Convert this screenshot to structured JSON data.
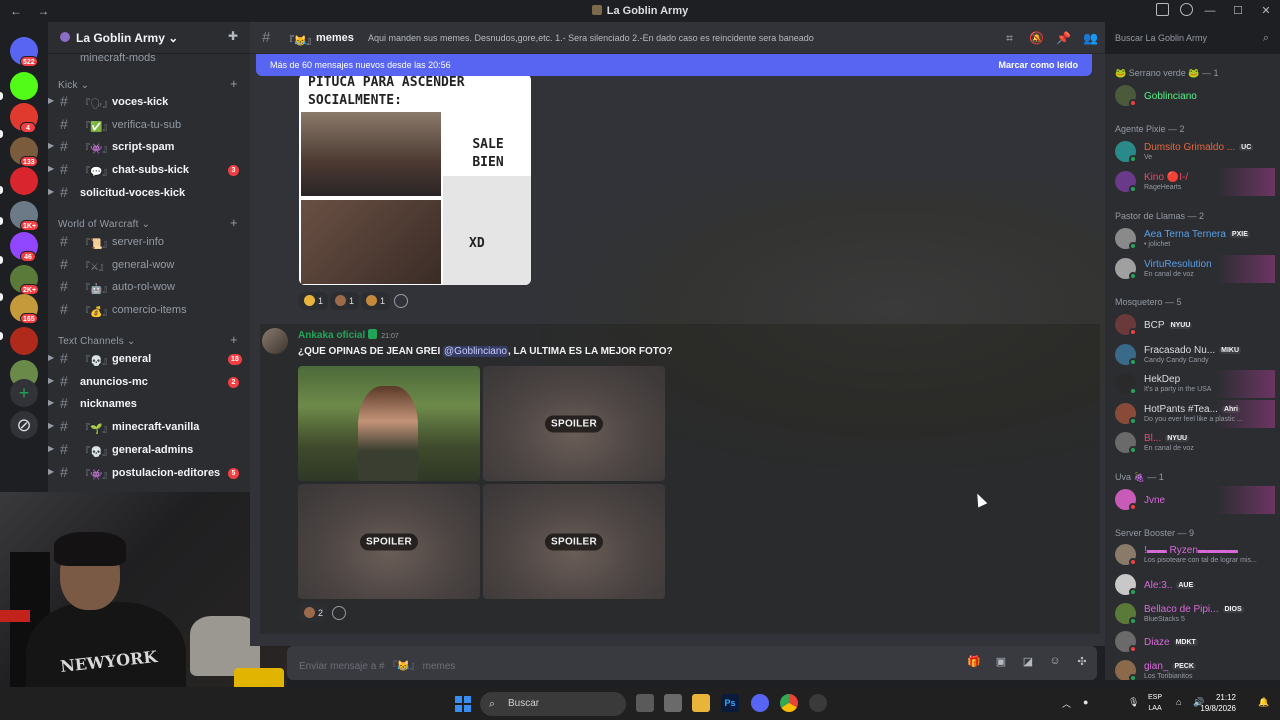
{
  "window": {
    "title": "La Goblin Army",
    "nav": "← →",
    "controls": [
      "—",
      "☐",
      "✕"
    ]
  },
  "guild": {
    "name": "La Goblin Army ⌄"
  },
  "servers": [
    {
      "badge": "522",
      "color": "#5865f2"
    },
    {
      "badge": "",
      "color": "#53fc18"
    },
    {
      "badge": "4",
      "color": "#e03a2e"
    },
    {
      "badge": "133",
      "color": "#7a5c3c"
    },
    {
      "badge": "",
      "color": "#d9262e"
    },
    {
      "badge": "1K+",
      "color": "#6b7a86"
    },
    {
      "badge": "46",
      "color": "#9146ff"
    },
    {
      "badge": "2K+",
      "color": "#5a7a3a"
    },
    {
      "badge": "165",
      "color": "#c49a3a"
    },
    {
      "badge": "",
      "color": "#b02a1c"
    },
    {
      "badge": "",
      "color": "#6a8a4a"
    }
  ],
  "categories": {
    "kick": "Kick ⌄",
    "wow": "World of Warcraft ⌄",
    "text": "Text Channels ⌄"
  },
  "channels": {
    "partial": "minecraft-mods",
    "kick": [
      {
        "emoji": "『🗣』",
        "name": "voces-kick",
        "unread": true,
        "badge": ""
      },
      {
        "emoji": "『✅』",
        "name": "verifica-tu-sub",
        "unread": false,
        "badge": ""
      },
      {
        "emoji": "『👾』",
        "name": "script-spam",
        "unread": true,
        "badge": ""
      },
      {
        "emoji": "『💬』",
        "name": "chat-subs-kick",
        "unread": true,
        "badge": "3"
      },
      {
        "emoji": "",
        "name": "solicitud-voces-kick",
        "unread": true,
        "badge": ""
      }
    ],
    "wow": [
      {
        "emoji": "『📜』",
        "name": "server-info",
        "unread": false,
        "badge": ""
      },
      {
        "emoji": "『⚔』",
        "name": "general-wow",
        "unread": false,
        "badge": ""
      },
      {
        "emoji": "『🤖』",
        "name": "auto-rol-wow",
        "unread": false,
        "badge": ""
      },
      {
        "emoji": "『💰』",
        "name": "comercio-items",
        "unread": false,
        "badge": ""
      }
    ],
    "text": [
      {
        "emoji": "『💀』",
        "name": "general",
        "unread": true,
        "badge": "18"
      },
      {
        "emoji": "",
        "name": "anuncios-mc",
        "unread": true,
        "badge": "2"
      },
      {
        "emoji": "",
        "name": "nicknames",
        "unread": true,
        "badge": ""
      },
      {
        "emoji": "『🌱』",
        "name": "minecraft-vanilla",
        "unread": true,
        "badge": ""
      },
      {
        "emoji": "『💀』",
        "name": "general-admins",
        "unread": true,
        "badge": ""
      },
      {
        "emoji": "『👾』",
        "name": "postulacion-editores",
        "unread": true,
        "badge": "5"
      }
    ]
  },
  "channel_header": {
    "emoji": "『😹』",
    "name": "memes",
    "topic": "Aqui manden sus memes. Desnudos,gore,etc. 1.- Sera silenciado 2.-En dado caso es reincidente sera baneado"
  },
  "search": {
    "placeholder": "Buscar La Goblin Army"
  },
  "new_messages": {
    "text": "Más de 60 mensajes nuevos desde las 20:56",
    "action": "Marcar como leído"
  },
  "meme": {
    "header": "PITUCA PARA ASCENDER\nSOCIALMENTE:",
    "top_right": "SALE\nBIEN",
    "bottom_right": "XD"
  },
  "reactions_1": [
    {
      "count": "1",
      "color": "#e8b43a"
    },
    {
      "count": "1",
      "color": "#9a6a4a"
    },
    {
      "count": "1",
      "color": "#c48a3a"
    }
  ],
  "message": {
    "author": "Ankaka oficial",
    "time": "21:07",
    "text_before": "¿QUE OPINAS DE JEAN GREI ",
    "mention": "@Goblinciano",
    "text_after": ", LA ULTIMA ES LA MEJOR FOTO?",
    "spoiler_label": "SPOILER"
  },
  "reactions_2": [
    {
      "count": "2",
      "color": "#9a6a4a"
    }
  ],
  "composer": {
    "placeholder": "Enviar mensaje a # 『😹』 memes"
  },
  "member_groups": [
    {
      "title": "🐸 Serrano verde 🐸 — 1"
    },
    {
      "title": "Agente Pixie — 2"
    },
    {
      "title": "Pastor de Llamas — 2"
    },
    {
      "title": "Mosquetero — 5"
    },
    {
      "title": "Uva 🍇 — 1"
    },
    {
      "title": "Server Booster — 9"
    }
  ],
  "members": [
    {
      "name": "Goblinciano",
      "sub": "",
      "badge": "",
      "color": "#57f287",
      "status": "#f23f43",
      "avatar": "#4a5a3a"
    },
    {
      "name": "Dumsito Grimaldo ...",
      "sub": "Ve",
      "badge": "UC",
      "color": "#e8663a",
      "status": "#23a559",
      "avatar": "#2a8a8a"
    },
    {
      "name": "Kino 🔴I-/",
      "sub": "RageHearts",
      "badge": "",
      "color": "#e84a6a",
      "status": "#23a559",
      "avatar": "#6a3a8a"
    },
    {
      "name": "Aea Terna Ternera",
      "sub": "• jolichet",
      "badge": "PXIE",
      "color": "#5aa0e8",
      "status": "#23a559",
      "avatar": "#8a8a8a"
    },
    {
      "name": "VirtuResolution",
      "sub": "En canal de voz",
      "badge": "",
      "color": "#5aa0e8",
      "status": "#23a559",
      "avatar": "#a0a0a0"
    },
    {
      "name": "BCP",
      "sub": "",
      "badge": "NYUU",
      "color": "#dbdee1",
      "status": "#f23f43",
      "avatar": "#6a3a3a"
    },
    {
      "name": "Fracasado Nu...",
      "sub": "Candy Candy Candy",
      "badge": "MIKU",
      "color": "#dbdee1",
      "status": "#23a559",
      "avatar": "#3a6a8a"
    },
    {
      "name": "HekDep",
      "sub": "It's a party in the USA",
      "badge": "",
      "color": "#dbdee1",
      "status": "#23a559",
      "avatar": "#2a2a2a"
    },
    {
      "name": "HotPants #Tea...",
      "sub": "Do you ever feel like a plastic ...",
      "badge": "Ahri",
      "color": "#dbdee1",
      "status": "#23a559",
      "avatar": "#8a4a3a"
    },
    {
      "name": "Bl...",
      "sub": "En canal de voz",
      "badge": "NYUU",
      "color": "#e84a6a",
      "status": "#23a559",
      "avatar": "#6a6a6a"
    },
    {
      "name": "Jvne",
      "sub": "",
      "badge": "",
      "color": "#d86ad8",
      "status": "#f23f43",
      "avatar": "#c85ab8"
    },
    {
      "name": "!▬▬ Ryzen▬▬▬▬",
      "sub": "Los pisoteare con tal de lograr mis...",
      "badge": "",
      "color": "#d86ad8",
      "status": "#f23f43",
      "avatar": "#8a7a6a"
    },
    {
      "name": "Ale:3..",
      "sub": "",
      "badge": "AUE",
      "color": "#d86ad8",
      "status": "#23a559",
      "avatar": "#c8c8c8"
    },
    {
      "name": "Bellaco de Pipi...",
      "sub": "BlueStacks 5",
      "badge": "DIOS",
      "color": "#d86ad8",
      "status": "#23a559",
      "avatar": "#5a7a3a"
    },
    {
      "name": "Diaze",
      "sub": "",
      "badge": "MDKT",
      "color": "#d86ad8",
      "status": "#f23f43",
      "avatar": "#6a6a6a"
    },
    {
      "name": "gian_",
      "sub": "Los Toribianitos",
      "badge": "PECK",
      "color": "#d86ad8",
      "status": "#23a559",
      "avatar": "#8a6a4a"
    }
  ],
  "taskbar": {
    "search": "Buscar",
    "lang1": "ESP",
    "lang2": "LAA",
    "time": "21:12",
    "date": "19/8/2026"
  },
  "webcam": {
    "shirt": "NEWYORK"
  }
}
